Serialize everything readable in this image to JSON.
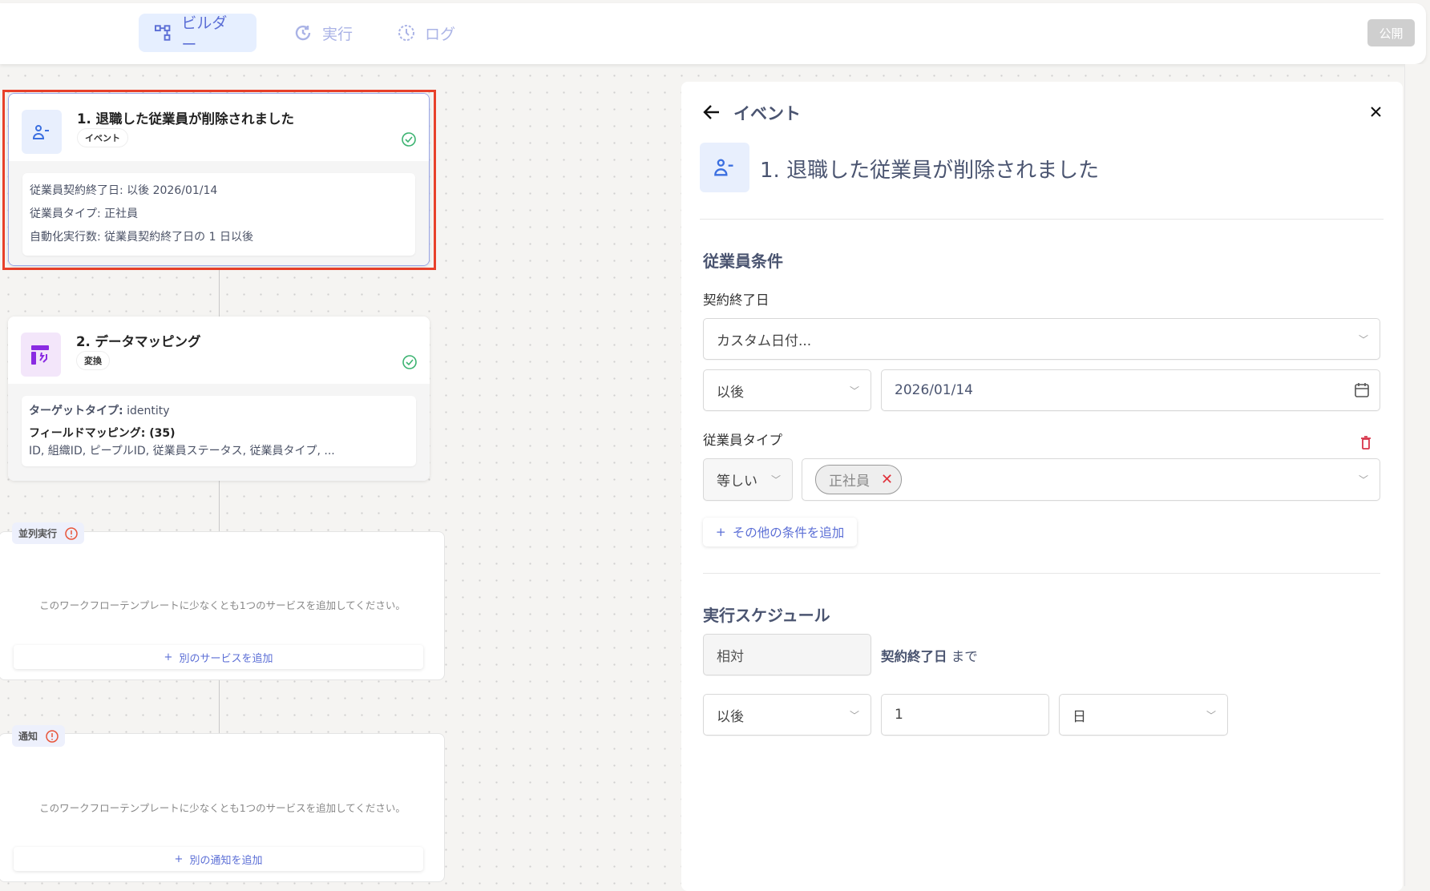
{
  "header": {
    "tabs": [
      {
        "label": "ビルダー",
        "icon": "flow-icon",
        "active": true
      },
      {
        "label": "実行",
        "icon": "history-icon"
      },
      {
        "label": "ログ",
        "icon": "clock-icon"
      }
    ],
    "publish_label": "公開"
  },
  "canvas": {
    "step1": {
      "title": "1. 退職した従業員が削除されました",
      "badge": "イベント",
      "lines": [
        "従業員契約終了日: 以後 2026/01/14",
        "従業員タイプ: 正社員",
        "自動化実行数: 従業員契約終了日の 1 日以後"
      ]
    },
    "step2": {
      "title": "2. データマッピング",
      "badge": "変換",
      "target_label": "ターゲットタイプ:",
      "target_value": "identity",
      "mapping_label": "フィールドマッピング: (35)",
      "mapping_fields": "ID, 組織ID, ピープルID, 従業員ステータス, 従業員タイプ, ..."
    },
    "parallel": {
      "label": "並列実行",
      "message": "このワークフローテンプレートに少なくとも1つのサービスを追加してください。",
      "button": "別のサービスを追加"
    },
    "notification": {
      "label": "通知",
      "message": "このワークフローテンプレートに少なくとも1つのサービスを追加してください。",
      "button": "別の通知を追加"
    }
  },
  "panel": {
    "back_title": "イベント",
    "event_title": "1. 退職した従業員が削除されました",
    "conditions": {
      "heading": "従業員条件",
      "end_date_label": "契約終了日",
      "date_mode": "カスタム日付...",
      "operator": "以後",
      "date": "2026/01/14",
      "type_label": "従業員タイプ",
      "type_operator": "等しい",
      "type_chip": "正社員",
      "add_condition": "その他の条件を追加"
    },
    "schedule": {
      "heading": "実行スケジュール",
      "mode": "相対",
      "ref_field": "契約終了日",
      "ref_suffix": "まで",
      "direction": "以後",
      "amount": "1",
      "unit": "日"
    }
  },
  "colors": {
    "accent": "#5c6fd6",
    "success": "#3cb371",
    "danger": "#e0303a",
    "highlight": "#e8402a"
  }
}
